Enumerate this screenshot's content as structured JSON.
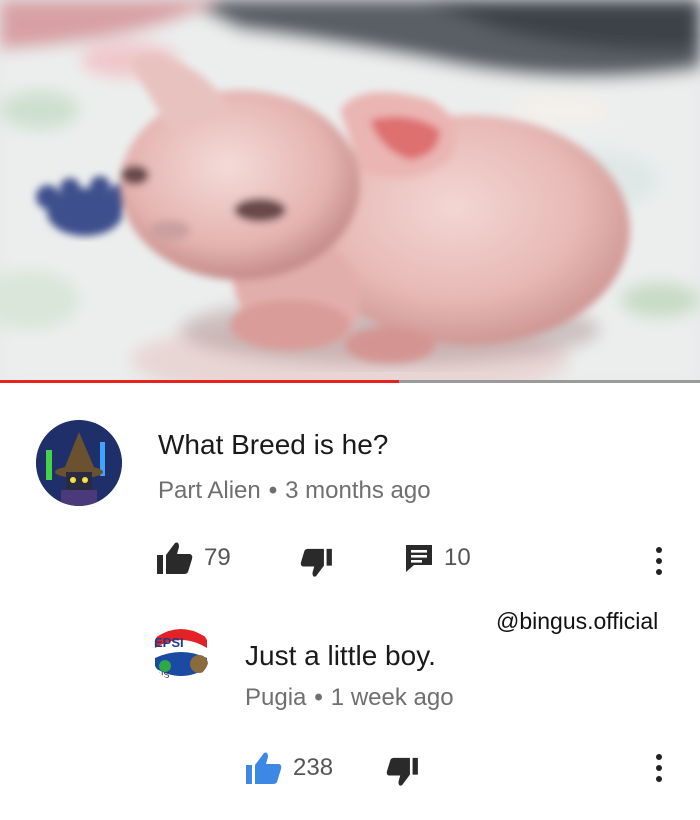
{
  "video": {
    "progress": 0.57,
    "colors": {
      "played": "#e52420",
      "track": "#9a9a9a"
    }
  },
  "watermark": "@bingus.official",
  "comments": [
    {
      "text": "What Breed is he?",
      "author": "Part Alien",
      "time": "3 months ago",
      "likes": "79",
      "replies": "10",
      "like_active": false,
      "avatar_icon": "wizard-avatar"
    },
    {
      "text": "Just a little boy.",
      "author": "Pugia",
      "time": "1 week ago",
      "likes": "238",
      "like_active": true,
      "avatar_icon": "pepsi-logo-avatar"
    }
  ],
  "colors": {
    "like_active": "#3e88e5",
    "icon_dark": "#2a2a2a"
  }
}
